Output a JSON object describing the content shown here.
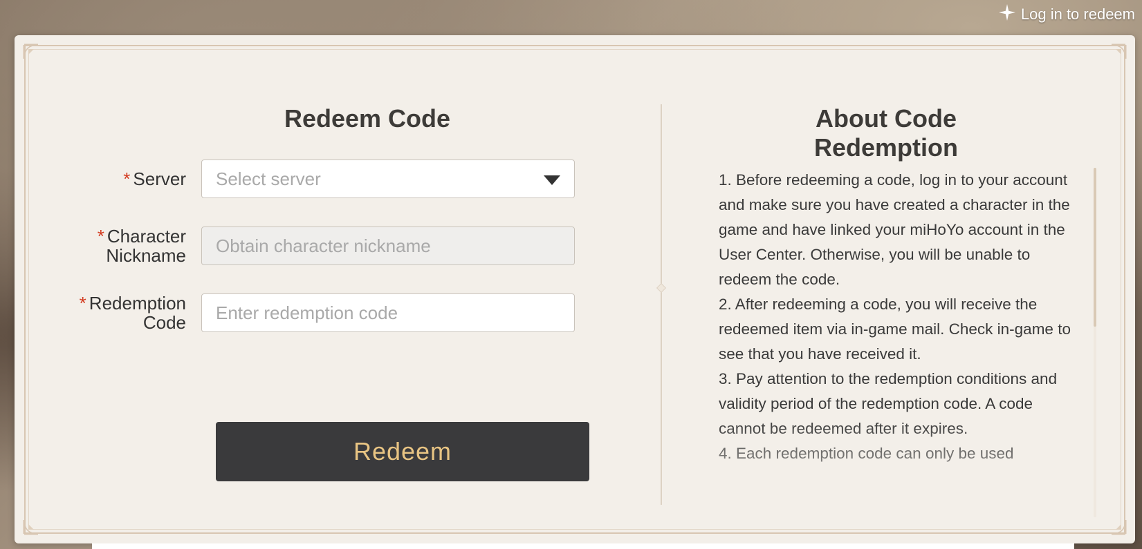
{
  "header": {
    "login_label": "Log in to redeem"
  },
  "form": {
    "title": "Redeem Code",
    "server": {
      "required_mark": "*",
      "label": "Server",
      "placeholder": "Select server"
    },
    "nickname": {
      "required_mark": "*",
      "label_line1": "Character",
      "label_line2": "Nickname",
      "placeholder": "Obtain character nickname"
    },
    "code": {
      "required_mark": "*",
      "label_line1": "Redemption",
      "label_line2": "Code",
      "placeholder": "Enter redemption code"
    },
    "submit_label": "Redeem"
  },
  "about": {
    "title": "About Code Redemption",
    "items": [
      "1. Before redeeming a code, log in to your account and make sure you have created a character in the game and have linked your miHoYo account in the User Center. Otherwise, you will be unable to redeem the code.",
      "2. After redeeming a code, you will receive the redeemed item via in-game mail. Check in-game to see that you have received it.",
      "3. Pay attention to the redemption conditions and validity period of the redemption code. A code cannot be redeemed after it expires.",
      "4. Each redemption code can only be used"
    ]
  },
  "colors": {
    "accent_gold": "#e8c483",
    "button_bg": "#3a3a3c",
    "required_red": "#d33a1f",
    "panel_bg": "#f3efe9"
  },
  "icons": {
    "login": "sparkle-star-icon",
    "dropdown": "caret-down-icon"
  }
}
